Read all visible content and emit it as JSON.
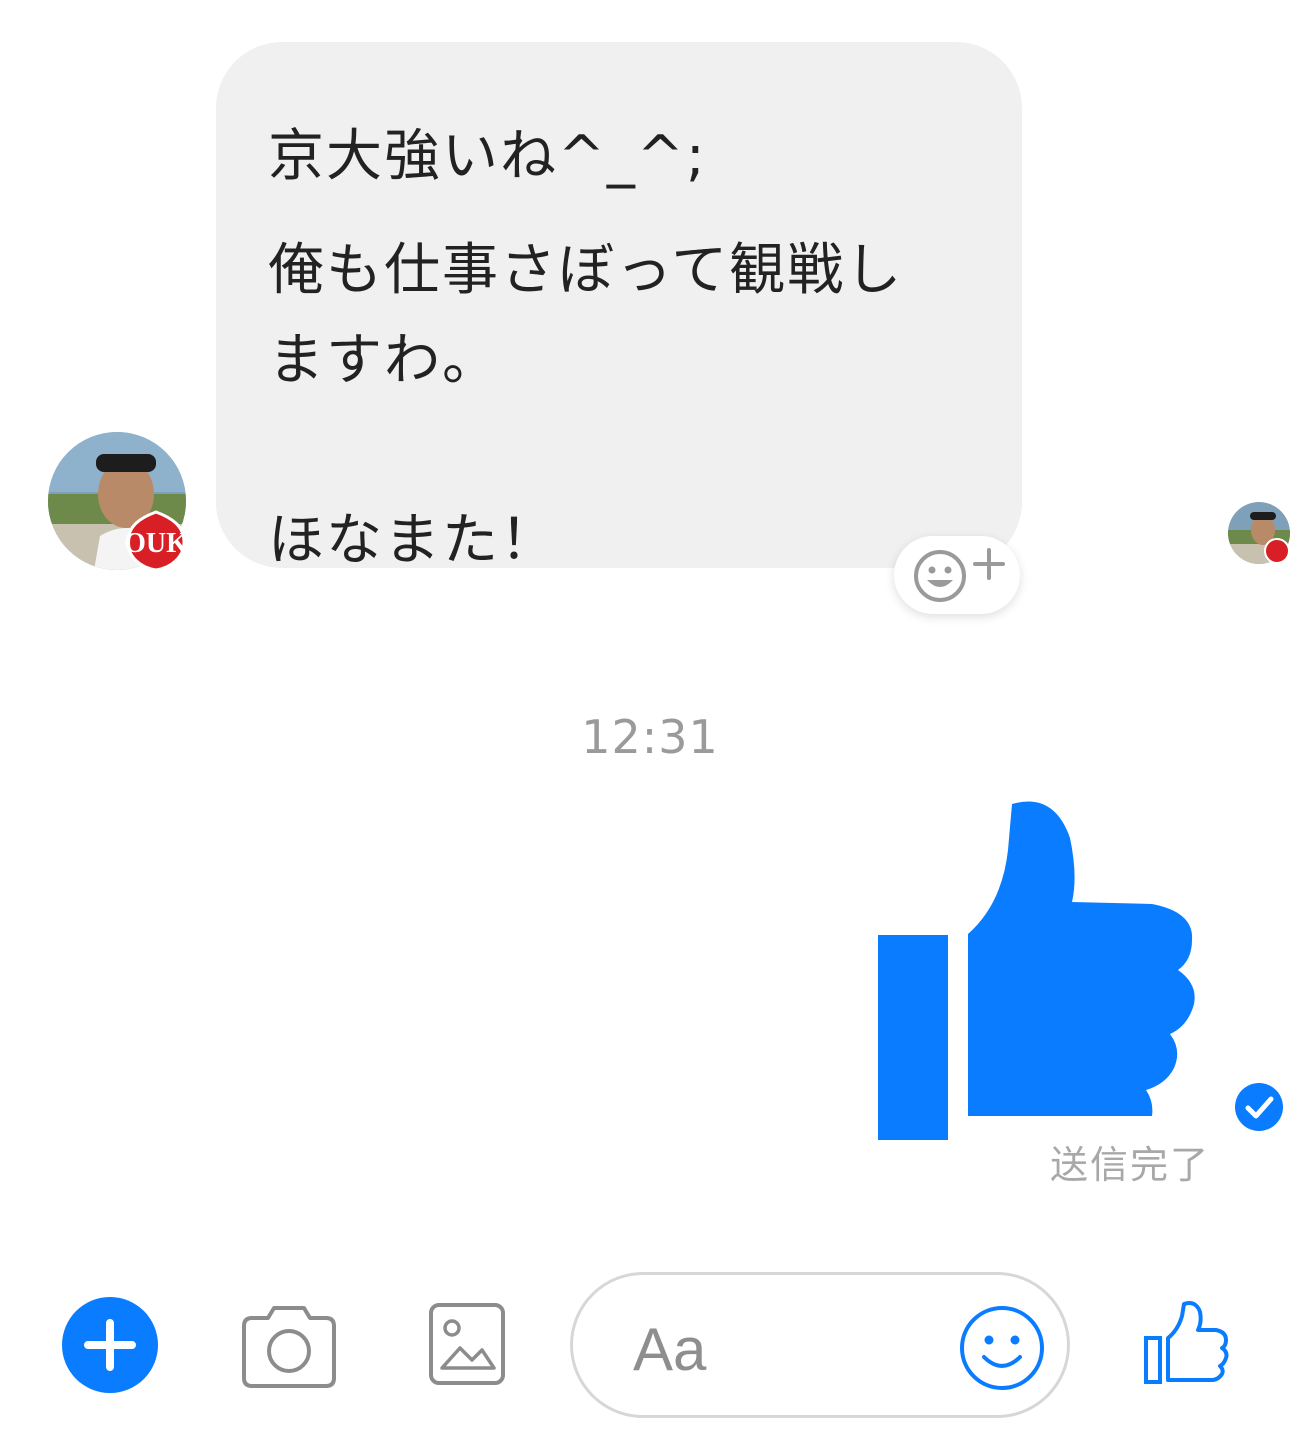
{
  "incoming_message": {
    "lines": [
      "京大強いね^_^;",
      "俺も仕事さぼって観戦し",
      "ますわ。",
      "ほなまた！"
    ]
  },
  "timestamp": "12:31",
  "outgoing_message": {
    "type": "like-sticker",
    "icon": "thumbs-up-icon",
    "status": "送信完了"
  },
  "composer": {
    "input_placeholder": "Aa",
    "buttons": [
      "plus-icon",
      "camera-icon",
      "gallery-icon",
      "emoji-icon",
      "like-icon"
    ]
  },
  "avatar_badge": "OUK",
  "colors": {
    "accent": "#0a7cff",
    "bubble_bg": "#f0f0f0",
    "muted_text": "#9a9a9a",
    "icon_gray": "#8c8c8c",
    "badge_red": "#d81f26"
  }
}
